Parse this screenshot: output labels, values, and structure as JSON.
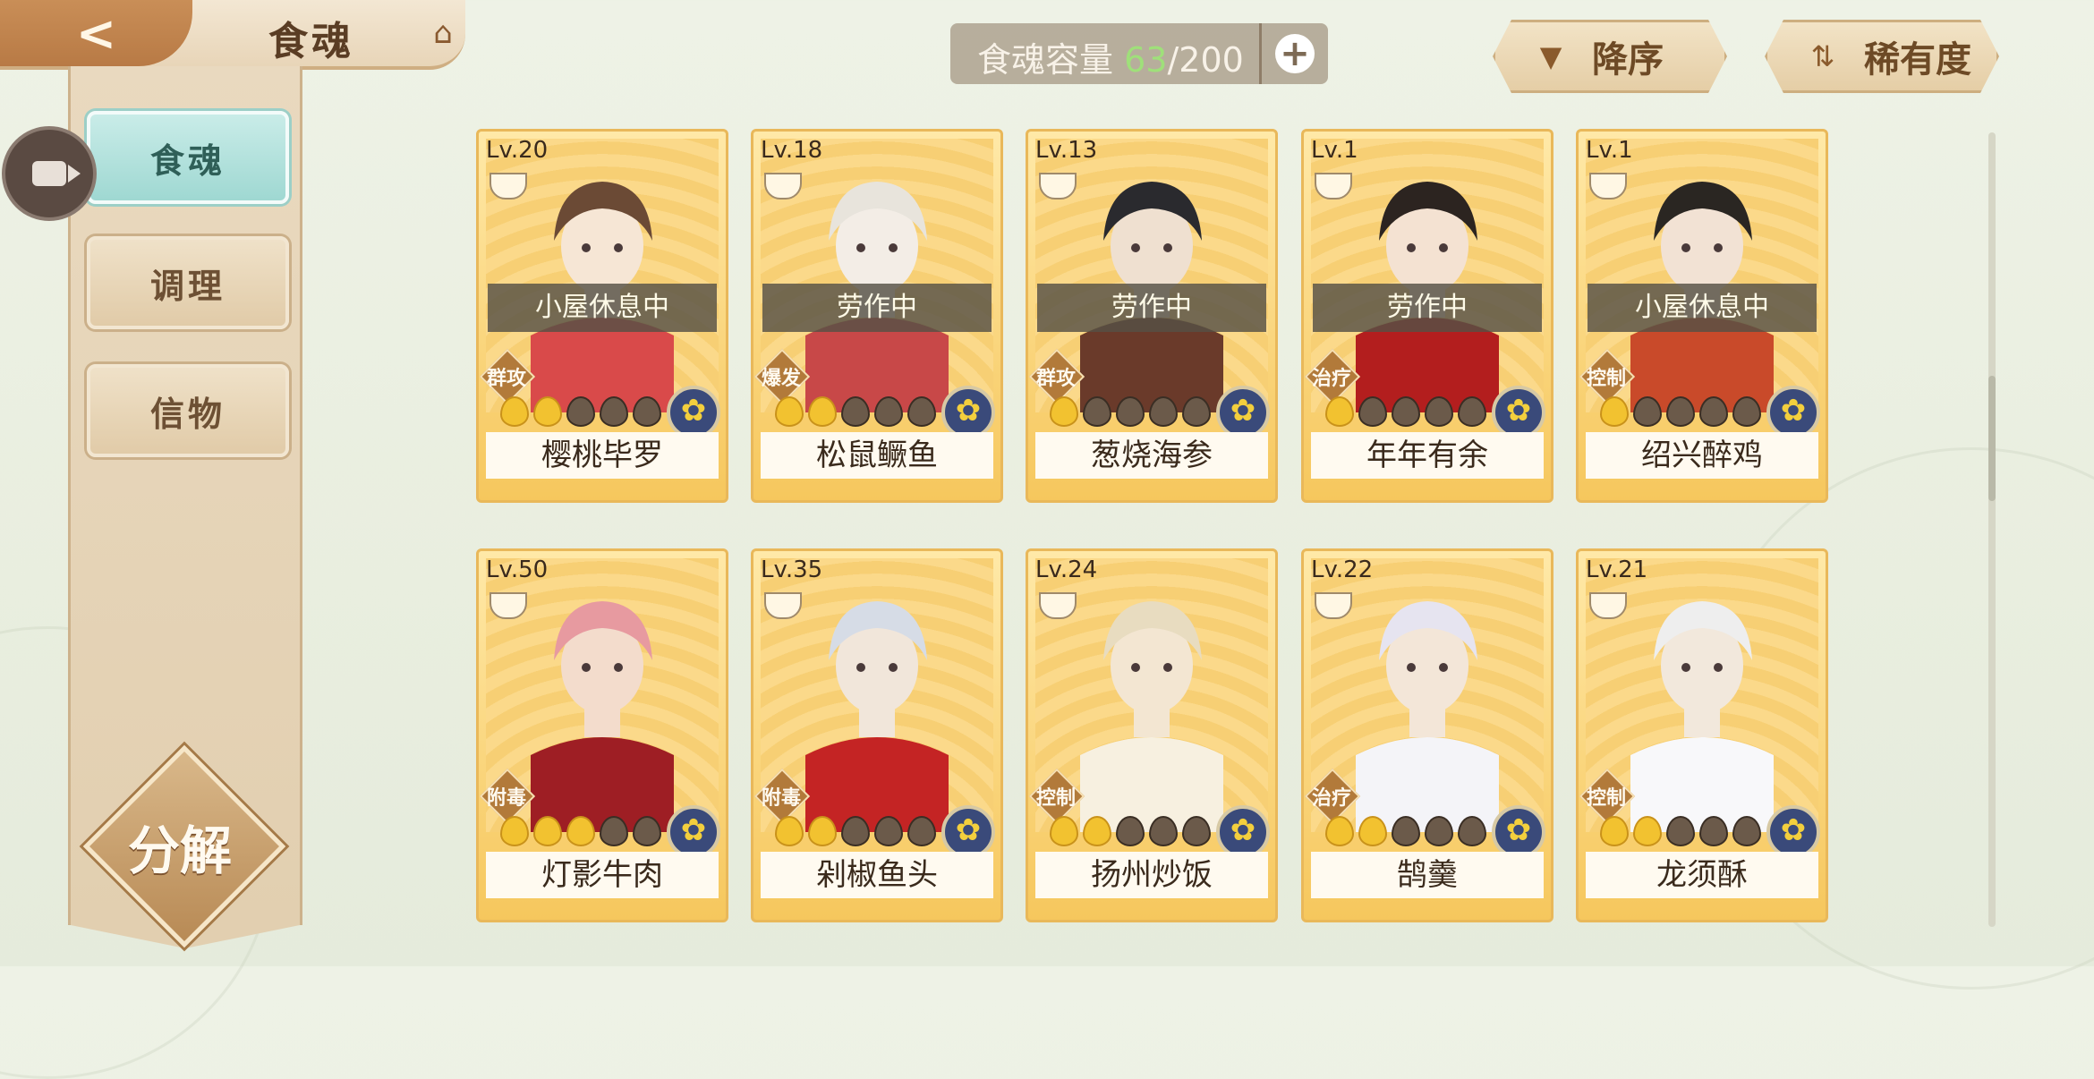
{
  "header": {
    "back_icon": "back-arrow-icon",
    "title": "食魂",
    "home_icon": "pavilion-icon"
  },
  "sidebar": {
    "items": [
      {
        "label": "食魂",
        "active": true
      },
      {
        "label": "调理",
        "active": false
      },
      {
        "label": "信物",
        "active": false
      }
    ],
    "decompose_label": "分解",
    "camera_icon": "video-camera-icon"
  },
  "capacity": {
    "label": "食魂容量",
    "current": "63",
    "max": "/200",
    "add": "+"
  },
  "sort": {
    "order_label": "降序",
    "rarity_label": "稀有度"
  },
  "colors": {
    "accent_gold": "#f6c75d",
    "status_overlay": "#55504a",
    "capacity_green": "#9fe07a"
  },
  "cards": [
    {
      "level": "Lv.20",
      "status": "小屋休息中",
      "role": "群攻",
      "stars": 2,
      "name": "樱桃毕罗"
    },
    {
      "level": "Lv.18",
      "status": "劳作中",
      "role": "爆发",
      "stars": 2,
      "name": "松鼠鳜鱼"
    },
    {
      "level": "Lv.13",
      "status": "劳作中",
      "role": "群攻",
      "stars": 1,
      "name": "葱烧海参"
    },
    {
      "level": "Lv.1",
      "status": "劳作中",
      "role": "治疗",
      "stars": 1,
      "name": "年年有余"
    },
    {
      "level": "Lv.1",
      "status": "小屋休息中",
      "role": "控制",
      "stars": 1,
      "name": "绍兴醉鸡"
    },
    {
      "level": "Lv.50",
      "status": "",
      "role": "附毒",
      "stars": 3,
      "name": "灯影牛肉"
    },
    {
      "level": "Lv.35",
      "status": "",
      "role": "附毒",
      "stars": 2,
      "name": "剁椒鱼头"
    },
    {
      "level": "Lv.24",
      "status": "",
      "role": "控制",
      "stars": 2,
      "name": "扬州炒饭"
    },
    {
      "level": "Lv.22",
      "status": "",
      "role": "治疗",
      "stars": 2,
      "name": "鹄羹"
    },
    {
      "level": "Lv.21",
      "status": "",
      "role": "控制",
      "stars": 2,
      "name": "龙须酥"
    }
  ]
}
